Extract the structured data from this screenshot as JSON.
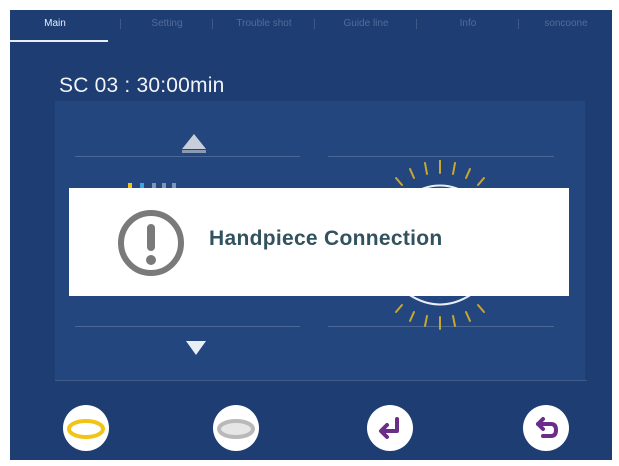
{
  "tabs": [
    {
      "label": "Main",
      "active": true
    },
    {
      "label": "Setting",
      "active": false
    },
    {
      "label": "Trouble shot",
      "active": false
    },
    {
      "label": "Guide line",
      "active": false
    },
    {
      "label": "Info",
      "active": false
    },
    {
      "label": "soncoone",
      "active": false
    }
  ],
  "title": "SC 03 : 30:00min",
  "dialog": {
    "message": "Handpiece Connection",
    "icon": "exclamation-circle-icon"
  },
  "bottom_buttons": [
    {
      "icon": "yellow-ring-icon"
    },
    {
      "icon": "gray-ring-icon"
    },
    {
      "icon": "enter-return-icon"
    },
    {
      "icon": "back-return-icon"
    }
  ],
  "colors": {
    "background": "#1d3d73",
    "panel": "#23467f",
    "accent_yellow": "#f2c417",
    "accent_purple": "#6b2d8a",
    "dialog_text": "#31525e"
  }
}
